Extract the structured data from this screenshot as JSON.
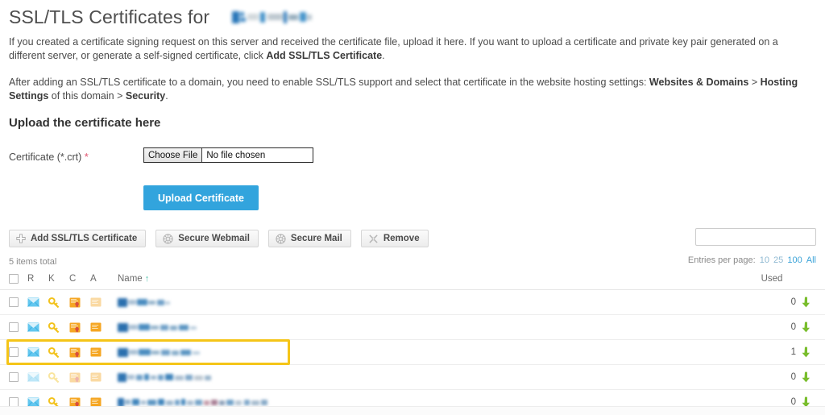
{
  "page": {
    "title": "SSL/TLS Certificates for",
    "domain_redacted": true,
    "intro_paragraph_1_part1": "If you created a certificate signing request on this server and received the certificate file, upload it here. If you want to upload a certificate and private key pair generated on a different server, or generate a self-signed certificate, click ",
    "intro_paragraph_1_bold": "Add SSL/TLS Certificate",
    "intro_paragraph_1_part2": ".",
    "intro_paragraph_2_part1": "After adding an SSL/TLS certificate to a domain, you need to enable SSL/TLS support and select that certificate in the website hosting settings: ",
    "intro_paragraph_2_bold1": "Websites & Domains",
    "intro_paragraph_2_sep": " > ",
    "intro_paragraph_2_bold2": "Hosting Settings",
    "intro_paragraph_2_part2": " of this domain > ",
    "intro_paragraph_2_bold3": "Security",
    "intro_paragraph_2_part3": "."
  },
  "upload_section": {
    "heading": "Upload the certificate here",
    "field_label": "Certificate (*.crt)",
    "required_marker": "*",
    "file_button_label": "Choose File",
    "file_status_text": "No file chosen",
    "submit_label": "Upload Certificate",
    "submit_color": "#32a4dd"
  },
  "toolbar": {
    "buttons": [
      {
        "label": "Add SSL/TLS Certificate",
        "icon": "plus-icon"
      },
      {
        "label": "Secure Webmail",
        "icon": "globe-icon"
      },
      {
        "label": "Secure Mail",
        "icon": "globe-icon"
      },
      {
        "label": "Remove",
        "icon": "remove-x-icon"
      }
    ],
    "search_placeholder": "",
    "search_value": "",
    "search_icon": "search-icon"
  },
  "list_meta": {
    "items_total": "5 items total",
    "entries_label": "Entries per page:",
    "entries_options": [
      {
        "label": "10",
        "active": false
      },
      {
        "label": "25",
        "active": false
      },
      {
        "label": "100",
        "active": true
      },
      {
        "label": "All",
        "active": true
      }
    ]
  },
  "table": {
    "columns": {
      "select_all": "",
      "r": "R",
      "k": "K",
      "c": "C",
      "a": "A",
      "name": "Name",
      "name_sort": "↑",
      "used": "Used"
    },
    "rows": [
      {
        "name_redacted": true,
        "used": "0",
        "download_icon": "download-arrow-icon",
        "highlighted": false,
        "flags": {
          "r": "mail-icon",
          "k": "key-icon",
          "c": "certificate-icon",
          "a": "certificate-plain-icon"
        },
        "faded_flags": [
          "a"
        ]
      },
      {
        "name_redacted": true,
        "used": "0",
        "download_icon": "download-arrow-icon",
        "highlighted": false,
        "flags": {
          "r": "mail-icon",
          "k": "key-icon",
          "c": "certificate-icon",
          "a": "certificate-plain-icon"
        },
        "faded_flags": []
      },
      {
        "name_redacted": true,
        "used": "1",
        "download_icon": "download-arrow-icon",
        "highlighted": true,
        "flags": {
          "r": "mail-icon",
          "k": "key-icon",
          "c": "certificate-icon",
          "a": "certificate-plain-icon"
        },
        "faded_flags": []
      },
      {
        "name_redacted": true,
        "used": "0",
        "download_icon": "download-arrow-icon",
        "highlighted": false,
        "flags": {
          "r": "mail-icon",
          "k": "key-icon",
          "c": "certificate-icon",
          "a": "certificate-plain-icon"
        },
        "faded_flags": [
          "r",
          "k",
          "c",
          "a"
        ]
      },
      {
        "name_redacted": true,
        "used": "0",
        "download_icon": "download-arrow-icon",
        "highlighted": false,
        "flags": {
          "r": "mail-icon",
          "k": "key-icon",
          "c": "certificate-icon",
          "a": "certificate-plain-icon"
        },
        "faded_flags": []
      }
    ]
  },
  "colors": {
    "accent_blue": "#32a4dd",
    "link_blue": "#3ba3d8",
    "highlight_yellow": "#f5c518",
    "download_green": "#79bd2c",
    "required_red": "#e0536f",
    "sort_teal": "#4bbfa8"
  }
}
